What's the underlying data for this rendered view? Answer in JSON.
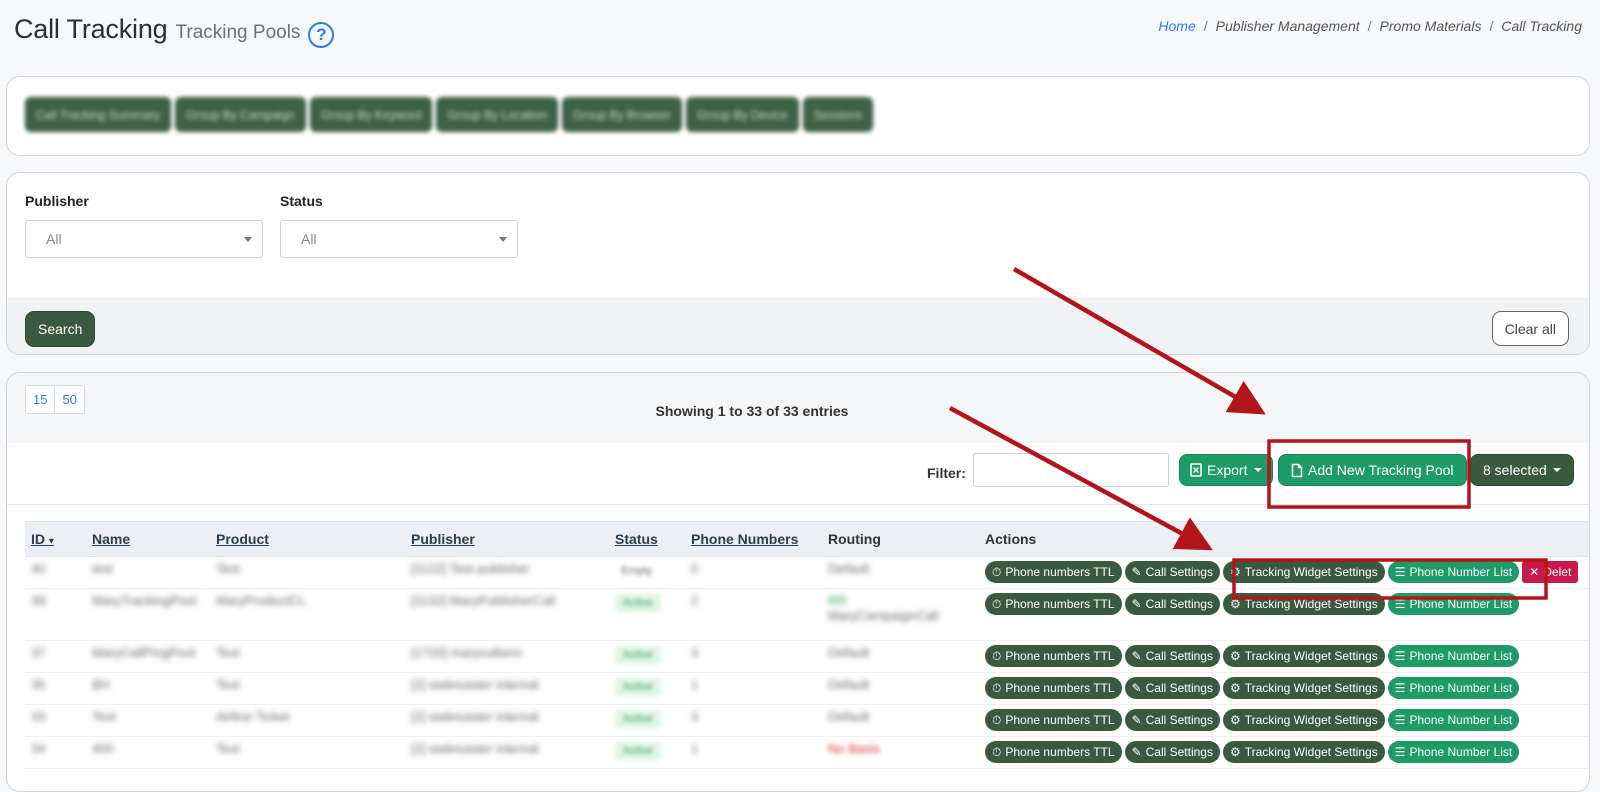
{
  "header": {
    "title": "Call Tracking",
    "subtitle": "Tracking Pools",
    "help_glyph": "?",
    "breadcrumb": [
      "Home",
      "Publisher Management",
      "Promo Materials",
      "Call Tracking"
    ],
    "breadcrumb_sep": "/"
  },
  "nav_buttons": [
    "Call Tracking Summary",
    "Group By Campaign",
    "Group By Keyword",
    "Group By Location",
    "Group By Browser",
    "Group By Device",
    "Sessions"
  ],
  "filters": {
    "publisher_label": "Publisher",
    "publisher_value": "All",
    "status_label": "Status",
    "status_value": "All",
    "search_label": "Search",
    "clear_label": "Clear all"
  },
  "table_controls": {
    "page_sizes": [
      "15",
      "50"
    ],
    "showing_text": "Showing 1 to 33 of 33 entries",
    "filter_label": "Filter:",
    "filter_value": "",
    "export_label": "Export",
    "add_pool_label": "Add New Tracking Pool",
    "selected_label": "8 selected"
  },
  "columns": {
    "id": "ID",
    "name": "Name",
    "product": "Product",
    "publisher": "Publisher",
    "status": "Status",
    "phone_numbers": "Phone Numbers",
    "routing": "Routing",
    "actions": "Actions"
  },
  "actions": {
    "ttl": "Phone numbers TTL",
    "call_settings": "Call Settings",
    "widget_settings": "Tracking Widget Settings",
    "phone_list": "Phone Number List",
    "delete": "Delet"
  },
  "rows": [
    {
      "id": "40",
      "name": "test",
      "product": "Test",
      "publisher": "[1122] Test publisher",
      "status": "Empty",
      "phones": "0",
      "routing": "Default",
      "routing2": ""
    },
    {
      "id": "39",
      "name": "MaryTrackingPool",
      "product": "MaryProductCL",
      "publisher": "[1132] MaryPublisherCall",
      "status": "Active",
      "phones": "2",
      "routing": "RR",
      "routing2": "MaryCampaignCall"
    },
    {
      "id": "37",
      "name": "MaryCallPingPool",
      "product": "Test",
      "publisher": "[1720] maryculbero",
      "status": "Active",
      "phones": "3",
      "routing": "Default",
      "routing2": ""
    },
    {
      "id": "35",
      "name": "BH",
      "product": "Test",
      "publisher": "[2] webmaster internal",
      "status": "Active",
      "phones": "1",
      "routing": "Default",
      "routing2": ""
    },
    {
      "id": "33",
      "name": "Test",
      "product": "Airline Ticket",
      "publisher": "[2] webmaster internal",
      "status": "Active",
      "phones": "3",
      "routing": "Default",
      "routing2": ""
    },
    {
      "id": "34",
      "name": "400",
      "product": "Test",
      "publisher": "[2] webmaster internal",
      "status": "Active",
      "phones": "1",
      "routing": "No Basis",
      "routing2": ""
    }
  ],
  "colors": {
    "dark_green": "#3a5a40",
    "teal": "#1f9b67",
    "link_blue": "#2a7df0",
    "annotation_red": "#b3141b",
    "delete_red": "#c8194a"
  }
}
